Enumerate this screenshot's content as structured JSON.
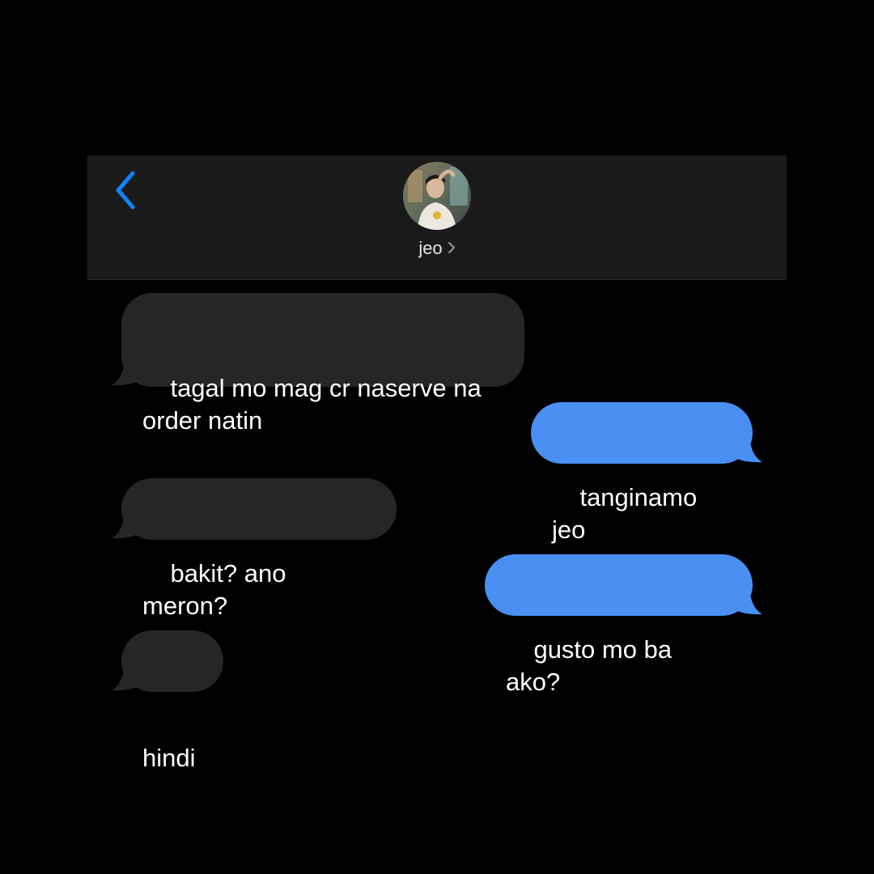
{
  "header": {
    "contact_name": "jeo",
    "back_icon": "chevron-left-icon",
    "disclosure_icon": "chevron-right-icon",
    "avatar": "contact-avatar-photo"
  },
  "colors": {
    "background": "#000000",
    "header_background": "#1a1a1a",
    "incoming_bubble": "#262628",
    "outgoing_bubble": "#4a8ff2",
    "accent": "#0a84ff"
  },
  "messages": [
    {
      "sender": "contact",
      "text": "tagal mo mag cr naserve na\norder natin"
    },
    {
      "sender": "me",
      "text": "tanginamo jeo"
    },
    {
      "sender": "contact",
      "text": "bakit? ano meron?"
    },
    {
      "sender": "me",
      "text": "gusto mo ba ako?"
    },
    {
      "sender": "contact",
      "text": "hindi"
    }
  ]
}
